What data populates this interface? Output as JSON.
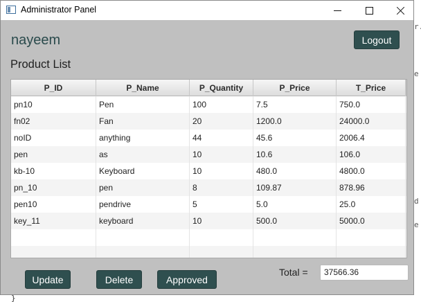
{
  "window": {
    "title": "Administrator Panel"
  },
  "header": {
    "username": "nayeem",
    "logout_label": "Logout"
  },
  "section_title": "Product List",
  "table": {
    "columns": [
      "P_ID",
      "P_Name",
      "P_Quantity",
      "P_Price",
      "T_Price"
    ],
    "rows": [
      [
        "pn10",
        "Pen",
        "100",
        "7.5",
        "750.0"
      ],
      [
        "fn02",
        "Fan",
        "20",
        "1200.0",
        "24000.0"
      ],
      [
        "noID",
        "anything",
        "44",
        "45.6",
        "2006.4"
      ],
      [
        "pen",
        "as",
        "10",
        "10.6",
        "106.0"
      ],
      [
        "kb-10",
        "Keyboard",
        "10",
        "480.0",
        "4800.0"
      ],
      [
        "pn_10",
        "pen",
        "8",
        "109.87",
        "878.96"
      ],
      [
        "pen10",
        "pendrive",
        "5",
        "5.0",
        "25.0"
      ],
      [
        "key_11",
        "keyboard",
        "10",
        "500.0",
        "5000.0"
      ]
    ],
    "empty_rows": 2
  },
  "actions": {
    "update_label": "Update",
    "delete_label": "Delete",
    "approved_label": "Approved"
  },
  "total": {
    "label": "Total  =",
    "value": "37566.36"
  },
  "colors": {
    "button_bg": "#2f4f4f",
    "window_bg": "#c0c0c0",
    "username_color": "#2a4a4c"
  },
  "icons": [
    "app-window-icon",
    "minimize-icon",
    "maximize-icon",
    "close-icon"
  ]
}
